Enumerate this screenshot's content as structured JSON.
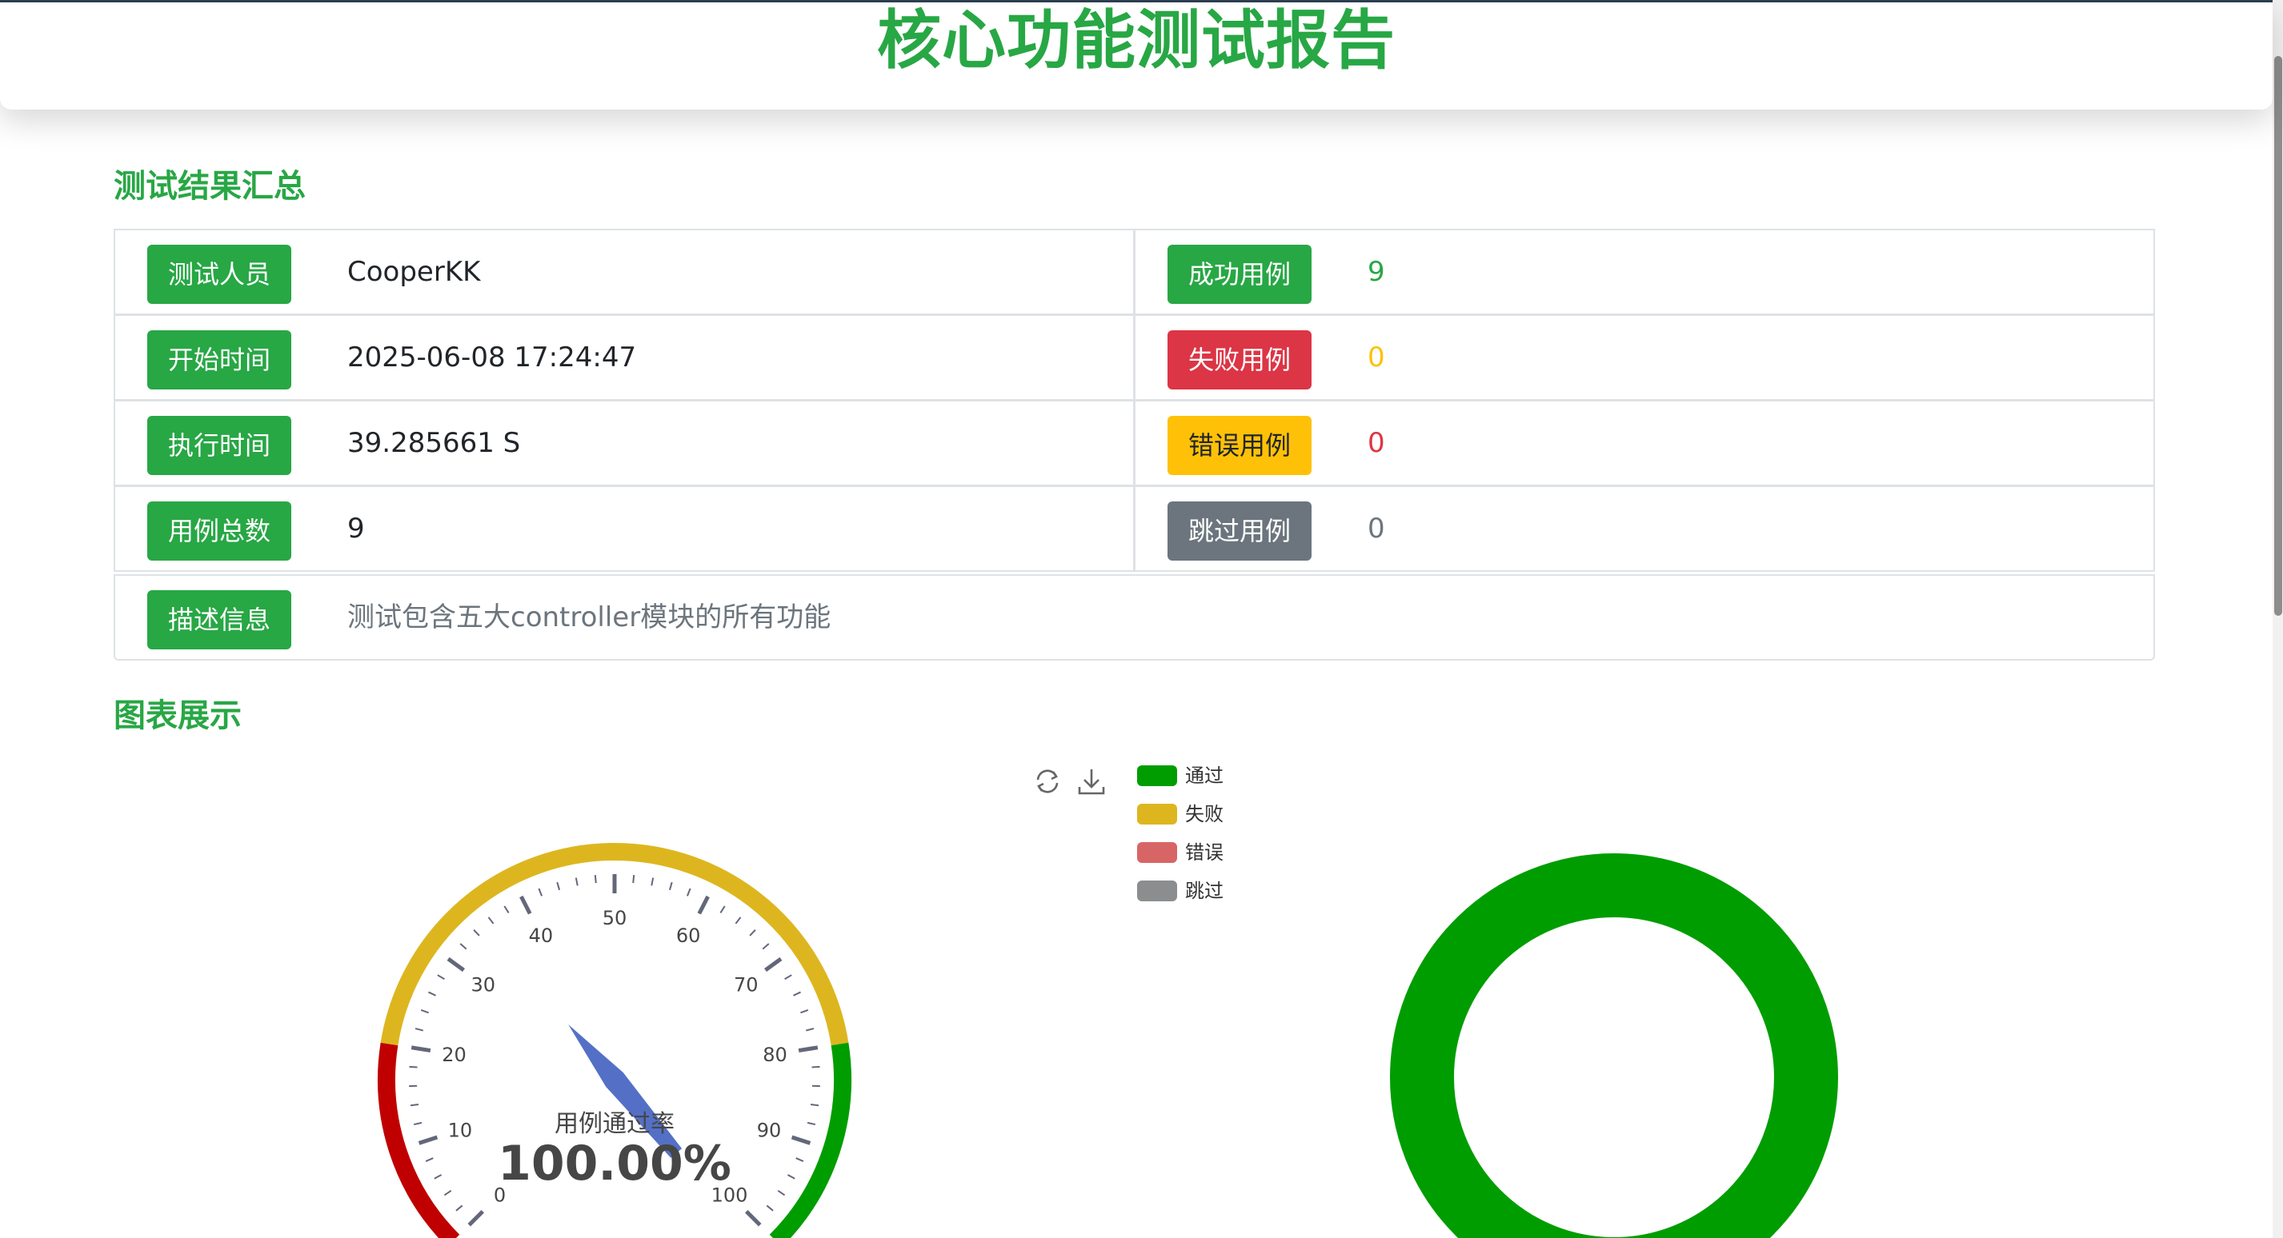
{
  "page": {
    "title": "核心功能测试报告"
  },
  "summary": {
    "section_title": "测试结果汇总",
    "tester_label": "测试人员",
    "tester_value": "CooperKK",
    "start_label": "开始时间",
    "start_value": "2025-06-08 17:24:47",
    "duration_label": "执行时间",
    "duration_value": "39.285661 S",
    "total_label": "用例总数",
    "total_value": "9",
    "success_label": "成功用例",
    "success_value": "9",
    "fail_label": "失败用例",
    "fail_value": "0",
    "error_label": "错误用例",
    "error_value": "0",
    "skip_label": "跳过用例",
    "skip_value": "0",
    "desc_label": "描述信息",
    "desc_value": "测试包含五大controller模块的所有功能"
  },
  "charts": {
    "section_title": "图表展示",
    "toolbox": [
      "refresh-icon",
      "download-icon"
    ],
    "colors": {
      "pass": "#009d00",
      "fail": "#ddb61f",
      "error": "#d86566",
      "skip": "#8b8d8f"
    }
  },
  "chart_data": [
    {
      "type": "gauge",
      "title": "用例通过率",
      "value": 100.0,
      "value_text": "100.00%",
      "min": 0,
      "max": 100,
      "ticks": [
        "0",
        "10",
        "20",
        "30",
        "40",
        "50",
        "60",
        "70",
        "80",
        "90",
        "100"
      ],
      "bands": [
        {
          "from": 0,
          "to": 20,
          "color": "#c00000"
        },
        {
          "from": 20,
          "to": 80,
          "color": "#ddb61f"
        },
        {
          "from": 80,
          "to": 100,
          "color": "#009d00"
        }
      ]
    },
    {
      "type": "pie",
      "legend_position": "top-left",
      "categories": [
        "通过",
        "失败",
        "错误",
        "跳过"
      ],
      "values": [
        9,
        0,
        0,
        0
      ],
      "colors": [
        "#009d00",
        "#ddb61f",
        "#d86566",
        "#8b8d8f"
      ]
    }
  ]
}
